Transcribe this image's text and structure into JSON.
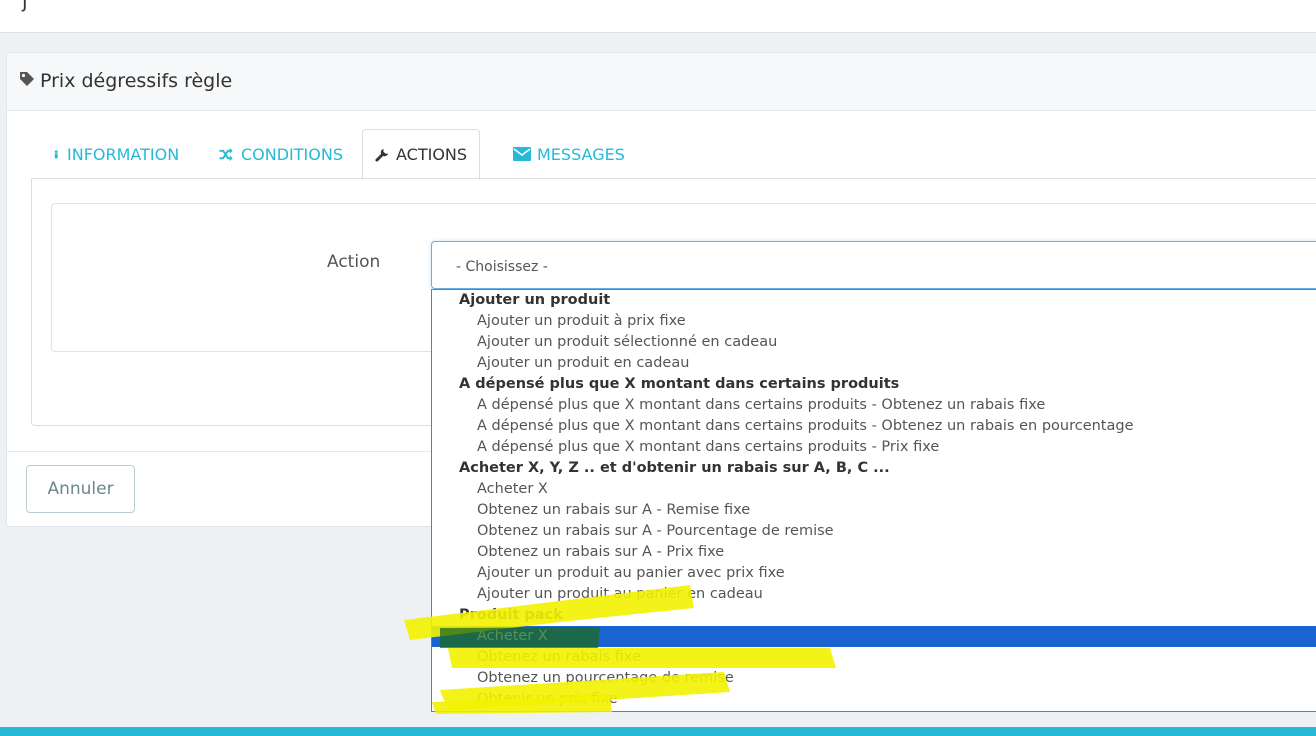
{
  "topbar": {
    "glyph": "j"
  },
  "panel": {
    "title": "Prix dégressifs règle",
    "icon": "tag-icon"
  },
  "tabs": [
    {
      "label": "INFORMATION",
      "icon": "info-icon"
    },
    {
      "label": "CONDITIONS",
      "icon": "shuffle-icon"
    },
    {
      "label": "ACTIONS",
      "icon": "wrench-icon",
      "active": true
    },
    {
      "label": "MESSAGES",
      "icon": "envelope-icon"
    }
  ],
  "form": {
    "action_label": "Action",
    "select_value": "- Choisissez -"
  },
  "dropdown": {
    "groups": [
      {
        "label": "Ajouter un produit",
        "options": [
          "Ajouter un produit à prix fixe",
          "Ajouter un produit sélectionné en cadeau",
          "Ajouter un produit en cadeau"
        ]
      },
      {
        "label": "A dépensé plus que X montant dans certains produits",
        "options": [
          "A dépensé plus que X montant dans certains produits - Obtenez un rabais fixe",
          "A dépensé plus que X montant dans certains produits - Obtenez un rabais en pourcentage",
          "A dépensé plus que X montant dans certains produits - Prix fixe"
        ]
      },
      {
        "label": "Acheter X, Y, Z .. et d'obtenir un rabais sur A, B, C ...",
        "options": [
          "Acheter X",
          "Obtenez un rabais sur A - Remise fixe",
          "Obtenez un rabais sur A - Pourcentage de remise",
          "Obtenez un rabais sur A - Prix fixe",
          "Ajouter un produit au panier avec prix fixe",
          "Ajouter un produit au panier en cadeau"
        ]
      },
      {
        "label": "Produit pack",
        "options": [
          "Acheter X",
          "Obtenez un rabais fixe",
          "Obtenez un pourcentage de remise",
          "Obtenir un prix fixe"
        ]
      }
    ],
    "selected": "Produit pack / Acheter X"
  },
  "buttons": {
    "cancel": "Annuler"
  },
  "colors": {
    "accent": "#25b9d7",
    "selection": "#1a64d1",
    "highlighter": "#f2f200"
  }
}
